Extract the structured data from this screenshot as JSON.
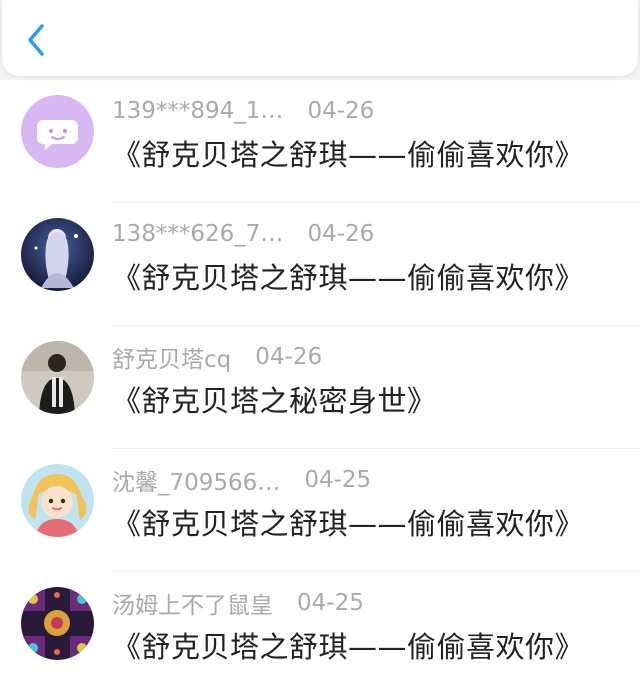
{
  "header": {
    "back_icon": "chevron-left-icon",
    "accent": "#2b9cf2"
  },
  "items": [
    {
      "user": "139***894_1…",
      "date": "04-26",
      "title": "《舒克贝塔之舒琪——偷偷喜欢你》",
      "avatar": "default-chat-avatar"
    },
    {
      "user": "138***626_7…",
      "date": "04-26",
      "title": "《舒克贝塔之舒琪——偷偷喜欢你》",
      "avatar": "anime-girl-avatar"
    },
    {
      "user": "舒克贝塔cq",
      "date": "04-26",
      "title": "《舒克贝塔之秘密身世》",
      "avatar": "person-photo-avatar"
    },
    {
      "user": "沈馨_709566…",
      "date": "04-25",
      "title": "《舒克贝塔之舒琪——偷偷喜欢你》",
      "avatar": "cartoon-girl-avatar"
    },
    {
      "user": "汤姆上不了鼠皇",
      "date": "04-25",
      "title": "《舒克贝塔之舒琪——偷偷喜欢你》",
      "avatar": "pattern-avatar"
    }
  ]
}
